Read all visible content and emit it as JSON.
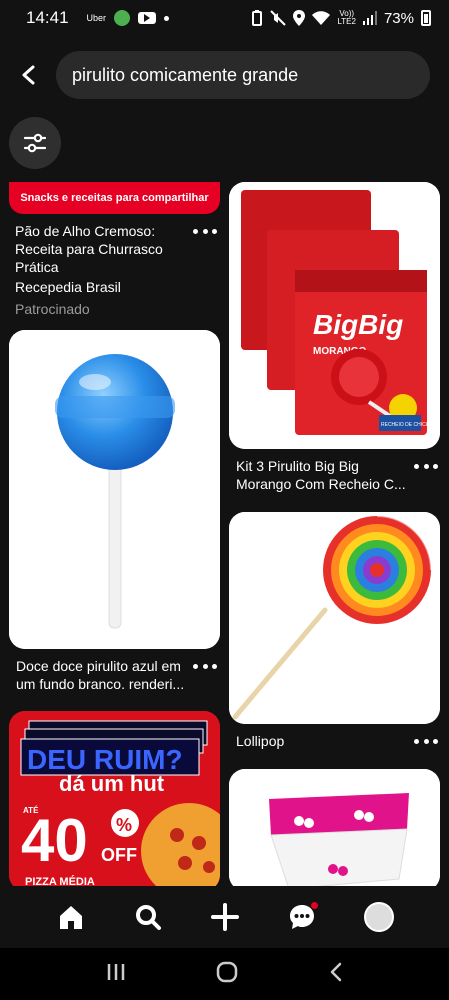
{
  "status": {
    "time": "14:41",
    "uber": "Uber",
    "network": "Vo))\nLTE2",
    "battery": "73%"
  },
  "search": {
    "query": "pirulito comicamente grande"
  },
  "pins": {
    "sponsored": {
      "banner": "Snacks e receitas para compartilhar",
      "title": "Pão de Alho Cremoso: Receita para Churrasco Prática",
      "source": "Recepedia Brasil",
      "sponsor": "Patrocinado"
    },
    "kit": {
      "title": "Kit 3 Pirulito Big Big Morango Com Recheio C...",
      "brand": "BigBig",
      "flavor": "MORANGO",
      "recheio": "RECHEIO DE CHICLE"
    },
    "blue": {
      "title": "Doce doce pirulito azul em um fundo branco. renderi..."
    },
    "lollipop": {
      "title": "Lollipop"
    },
    "ad": {
      "line1": "DEU RUIM?",
      "line2": "dá um hut",
      "ate": "ATÉ",
      "pct": "40",
      "pct_sign": "%",
      "off": "OFF",
      "footer": "PIZZA MÉDIA"
    }
  },
  "colors": {
    "brand": "#e60023",
    "background": "#121212"
  }
}
